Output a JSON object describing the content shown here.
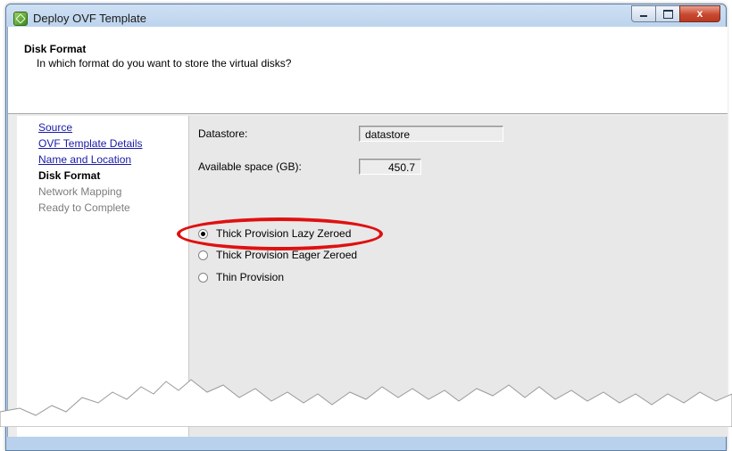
{
  "window": {
    "title": "Deploy OVF Template",
    "min_glyph": "",
    "max_glyph": "",
    "close_glyph": "x"
  },
  "header": {
    "title": "Disk Format",
    "subtitle": "In which format do you want to store the virtual disks?"
  },
  "nav": {
    "items": [
      {
        "label": "Source",
        "state": "link"
      },
      {
        "label": "OVF Template Details",
        "state": "link"
      },
      {
        "label": "Name and Location",
        "state": "link"
      },
      {
        "label": "Disk Format",
        "state": "active"
      },
      {
        "label": "Network Mapping",
        "state": "disabled"
      },
      {
        "label": "Ready to Complete",
        "state": "disabled"
      }
    ]
  },
  "main": {
    "datastore_label": "Datastore:",
    "datastore_value": "datastore",
    "available_label": "Available space (GB):",
    "available_value": "450.7",
    "options": [
      {
        "label": "Thick Provision Lazy Zeroed",
        "selected": true
      },
      {
        "label": "Thick Provision Eager Zeroed",
        "selected": false
      },
      {
        "label": "Thin Provision",
        "selected": false
      }
    ]
  },
  "colors": {
    "link": "#1a1aa8",
    "highlight": "#e01010",
    "disabled": "#7d7d7d"
  },
  "icons": [
    "vsphere-app-icon",
    "minimize-icon",
    "maximize-icon",
    "close-icon"
  ]
}
